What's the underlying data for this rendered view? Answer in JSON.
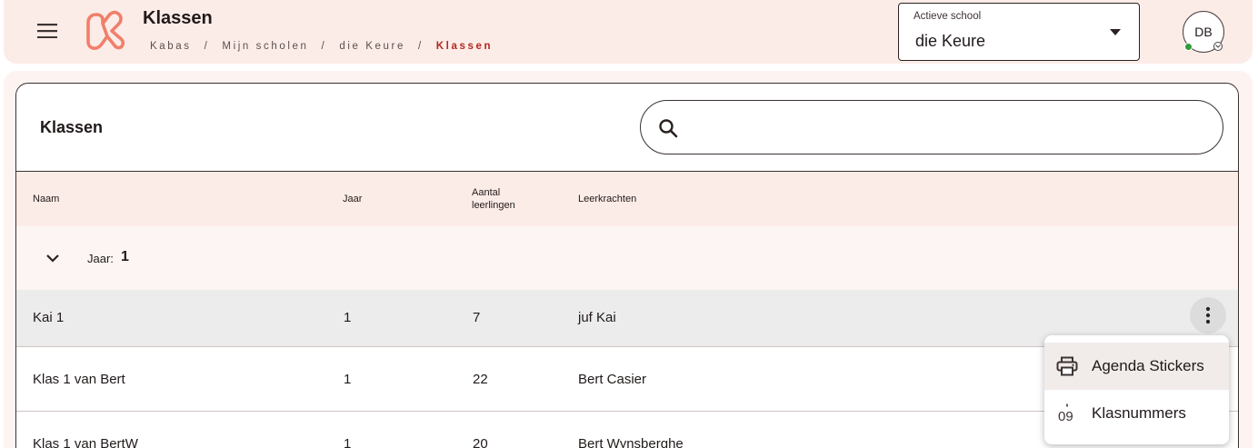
{
  "header": {
    "title": "Klassen",
    "breadcrumb": [
      "Kabas",
      "Mijn scholen",
      "die Keure",
      "Klassen"
    ],
    "school_select": {
      "label": "Actieve school",
      "value": "die Keure"
    },
    "avatar_initials": "DB",
    "colors": {
      "brand": "#f07f6a",
      "topbar": "#fcece8",
      "breadcrumb_current": "#b3261e",
      "online": "#2e9c3a"
    }
  },
  "card": {
    "title": "Klassen",
    "search_placeholder": ""
  },
  "table": {
    "columns": {
      "naam": "Naam",
      "jaar": "Jaar",
      "aantal_line1": "Aantal",
      "aantal_line2": "leerlingen",
      "leerkrachten": "Leerkrachten"
    },
    "group": {
      "label": "Jaar:",
      "value": "1"
    },
    "rows": [
      {
        "naam": "Kai 1",
        "jaar": "1",
        "aantal": "7",
        "leerkrachten": "juf Kai"
      },
      {
        "naam": "Klas 1 van Bert",
        "jaar": "1",
        "aantal": "22",
        "leerkrachten": "Bert Casier"
      },
      {
        "naam": "Klas 1 van BertW",
        "jaar": "1",
        "aantal": "20",
        "leerkrachten": "Bert Wynsberghe"
      }
    ]
  },
  "context_menu": {
    "items": [
      {
        "label": "Agenda Stickers",
        "icon": "printer-icon"
      },
      {
        "label": "Klasnummers",
        "icon": "numbers-icon"
      }
    ]
  }
}
